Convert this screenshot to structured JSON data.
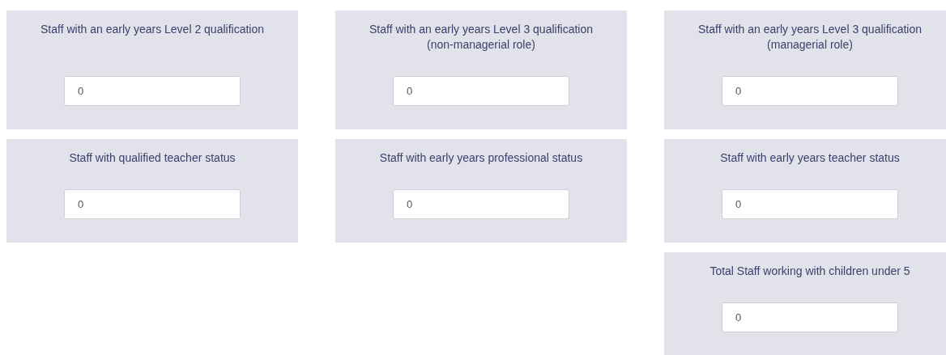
{
  "rows": [
    {
      "cells": [
        {
          "label": "Staff with an early years Level 2 qualification",
          "value": "0"
        },
        {
          "label": "Staff with an early years Level 3 qualification (non-managerial role)",
          "value": "0"
        },
        {
          "label": "Staff with an early years Level 3 qualification (managerial role)",
          "value": "0"
        }
      ]
    },
    {
      "cells": [
        {
          "label": "Staff with qualified teacher status",
          "value": "0"
        },
        {
          "label": "Staff with early years professional status",
          "value": "0"
        },
        {
          "label": "Staff with early years teacher status",
          "value": "0"
        }
      ]
    },
    {
      "cells": [
        {
          "label": "Total Staff working with children under 5",
          "value": "0"
        }
      ]
    }
  ]
}
